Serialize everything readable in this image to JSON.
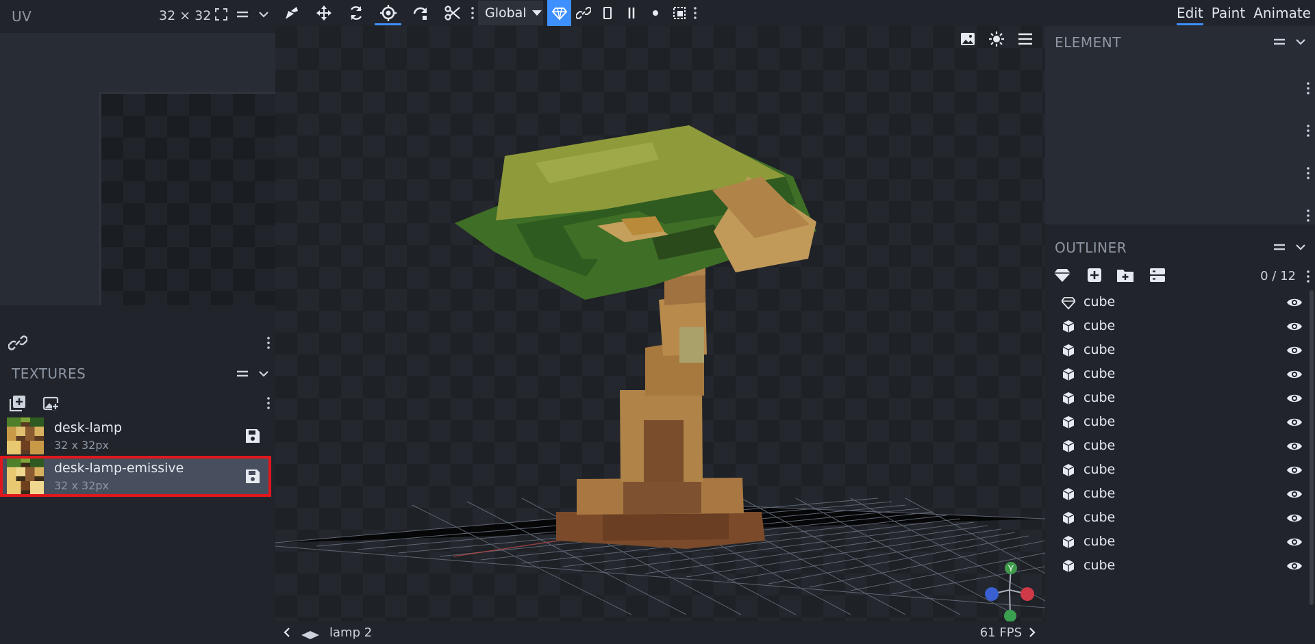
{
  "uv": {
    "title": "UV",
    "size": "32 ⨯ 32"
  },
  "toolbar": {
    "space_select": "Global",
    "tools": [
      "move-tool",
      "translate-tool",
      "rotate-tool",
      "pivot-tool",
      "vertex-snap-tool",
      "cut-tool"
    ]
  },
  "modes": [
    "Edit",
    "Paint",
    "Animate"
  ],
  "active_mode": "Edit",
  "textures": {
    "title": "TEXTURES",
    "items": [
      {
        "name": "desk-lamp",
        "size": "32 x 32px"
      },
      {
        "name": "desk-lamp-emissive",
        "size": "32 x 32px"
      }
    ]
  },
  "element": {
    "title": "ELEMENT"
  },
  "outliner": {
    "title": "OUTLINER",
    "count": "0 / 12",
    "items": [
      {
        "label": "cube",
        "icon": "gem-icon"
      },
      {
        "label": "cube",
        "icon": "cube-icon"
      },
      {
        "label": "cube",
        "icon": "cube-icon"
      },
      {
        "label": "cube",
        "icon": "cube-icon"
      },
      {
        "label": "cube",
        "icon": "cube-icon"
      },
      {
        "label": "cube",
        "icon": "cube-icon"
      },
      {
        "label": "cube",
        "icon": "cube-icon"
      },
      {
        "label": "cube",
        "icon": "cube-icon"
      },
      {
        "label": "cube",
        "icon": "cube-icon"
      },
      {
        "label": "cube",
        "icon": "cube-icon"
      },
      {
        "label": "cube",
        "icon": "cube-icon"
      },
      {
        "label": "cube",
        "icon": "cube-icon"
      }
    ]
  },
  "status": {
    "scene": "lamp 2",
    "fps": "61 FPS"
  },
  "gizmo": {
    "y_label": "Y"
  },
  "colors": {
    "accent": "#3e90ff",
    "highlight": "#e0181e"
  }
}
